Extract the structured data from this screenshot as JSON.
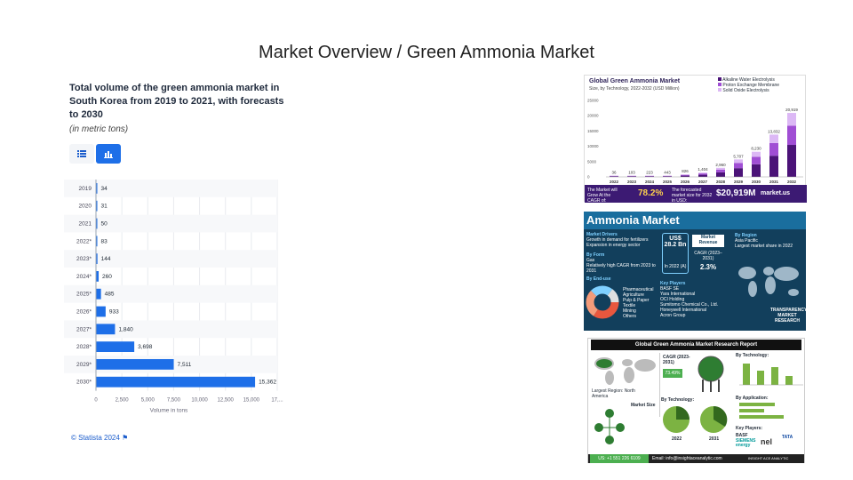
{
  "slide": {
    "title": "Market Overview / Green Ammonia Market"
  },
  "statista": {
    "title": "Total volume of the green ammonia market in South Korea from 2019 to 2021, with forecasts to 2030",
    "subtitle": "(in metric tons)",
    "footer": "© Statista 2024",
    "toggle_table_icon": "table-icon",
    "toggle_chart_icon": "bar-chart-icon"
  },
  "chart_data": {
    "type": "bar",
    "orientation": "horizontal",
    "categories": [
      "2019",
      "2020",
      "2021",
      "2022*",
      "2023*",
      "2024*",
      "2025*",
      "2026*",
      "2027*",
      "2028*",
      "2029*",
      "2030*"
    ],
    "values": [
      34,
      31,
      50,
      83,
      144,
      260,
      485,
      933,
      1840,
      3698,
      7511,
      15362
    ],
    "value_labels": [
      "34",
      "31",
      "50",
      "83",
      "144",
      "260",
      "485",
      "933",
      "1,840",
      "3,698",
      "7,511",
      "15,362"
    ],
    "xlabel": "Volume in tons",
    "xticks": [
      "0",
      "2,500",
      "5,000",
      "7,500",
      "10,000",
      "12,500",
      "15,000",
      "17,..."
    ],
    "xlim": [
      0,
      17500
    ],
    "grid": true,
    "bar_color": "#1e6fe8"
  },
  "image1": {
    "title": "Global Green Ammonia Market",
    "subtitle": "Size, by Technology, 2022-2032 (USD Million)",
    "legend": [
      "Alkaline Water Electrolysis",
      "Proton Exchange Membrane",
      "Solid Oxide Electrolysis"
    ],
    "years": [
      "2022",
      "2023",
      "2024",
      "2025",
      "2026",
      "2027",
      "2028",
      "2029",
      "2030",
      "2031",
      "2032"
    ],
    "labels": [
      "36",
      "103",
      "223",
      "443",
      "826",
      "1,404",
      "2,960",
      "5,707",
      "8,230",
      "13,832",
      "20,919"
    ],
    "yticks": [
      "25000",
      "20000",
      "15000",
      "10000",
      "5000",
      "0"
    ],
    "footer_left": "The Market will Grow At the CAGR of:",
    "cagr": "78.2%",
    "footer_mid": "The forecasted market size for 2032 in USD:",
    "size": "$20,919M",
    "brand": "market.us"
  },
  "image2": {
    "title": "Ammonia Market",
    "drivers_head": "Market Drivers",
    "drivers": [
      "Growth in demand for fertilizers",
      "Expansion in energy sector"
    ],
    "form_head": "By Form",
    "form": [
      "Gas",
      "Relatively high CAGR from 2023 to 2031"
    ],
    "enduse_head": "By End-use",
    "enduse": [
      "Pharmaceutical",
      "Agriculture",
      "Pulp & Paper",
      "Textile",
      "Mining",
      "Others"
    ],
    "revenue": "US$ 28.2 Bn",
    "revenue_year": "In 2022 (A)",
    "revenue_label": "Market Revenue",
    "cagr_label": "CAGR (2023–2031)",
    "cagr": "2.3%",
    "players_head": "Key Players",
    "players": [
      "BASF SE",
      "Yara International",
      "OCI Holding",
      "Sumitomo Chemical Co., Ltd.",
      "Honeywell International",
      "Acron Group"
    ],
    "region_head": "By Region",
    "region": [
      "Asia Pacific",
      "Largest market share in 2022"
    ],
    "brand": "TRANSPARENCY MARKET RESEARCH"
  },
  "image3": {
    "title": "Global Green Ammonia Market Research Report",
    "cagr_label": "CAGR (2023-2031)",
    "cagr": "73.49%",
    "technology_head": "By Technology:",
    "application_head": "By Application:",
    "largest_region": "Largest Region: North America",
    "market_size": "Market Size",
    "key_players": "Key Players:",
    "years": [
      "2022",
      "2031"
    ],
    "phone": "US: +1 551 226 6109",
    "email": "Email: info@insightaceanalytic.com",
    "brand": "INSIGHT ACE ANALYTIC",
    "logos": [
      "BASF",
      "SIEMENS energy",
      "nel",
      "TATA"
    ]
  }
}
